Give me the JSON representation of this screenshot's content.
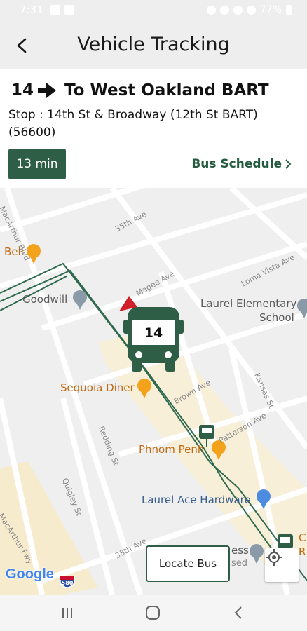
{
  "status_bar": {
    "time": "7:31",
    "battery": "77%"
  },
  "app_bar": {
    "title": "Vehicle Tracking"
  },
  "route": {
    "number": "14",
    "destination": "To West Oakland BART",
    "stop_line1": "Stop : 14th St & Broadway (12th St BART)",
    "stop_line2": "(56600)",
    "eta": "13 min",
    "schedule_label": "Bus Schedule"
  },
  "map": {
    "bus_number": "14",
    "pois": {
      "bell": "Bell",
      "goodwill": "Goodwill",
      "laurel_elem_1": "Laurel Elementary",
      "laurel_elem_2": "School",
      "sequoia": "Sequoia Diner",
      "phnom": "Phnom Penh",
      "ace": "Laurel Ace Hardware",
      "ess": "ess",
      "sed": "sed",
      "c": "C",
      "r": "R"
    },
    "streets": {
      "macarthur_blvd": "MacArthur Blvd",
      "st35": "35th Ave",
      "magee": "Magee Ave",
      "loma_vista": "Loma Vista Ave",
      "brown": "Brown Ave",
      "kansas": "Kansas St",
      "patterson": "Patterson Ave",
      "redding": "Redding St",
      "quigley": "Quigley St",
      "st38": "38th Ave",
      "macarthur_fwy": "MacArthur Fwy"
    },
    "google": "Google",
    "highway": "580",
    "locate_label": "Locate Bus"
  },
  "colors": {
    "brand_green": "#2e5f46",
    "route_line": "#2f6a4f"
  }
}
